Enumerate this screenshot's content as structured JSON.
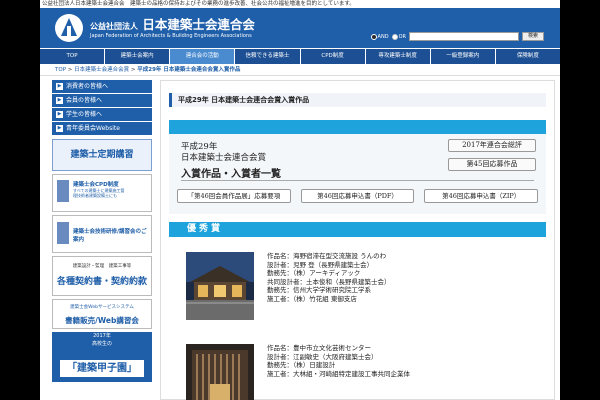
{
  "topline": "公益社団法人日本建築士会連合会　建築士の品格の保持およびその業務の進歩改善、社会公共の福祉増進を目的としています。",
  "header": {
    "org_prefix": "公益社団法人",
    "org_name": "日本建築士会連合会",
    "org_en": "Japan Federation of Architects & Building Engineers Associations",
    "radio_and": "AND",
    "radio_or": "OR",
    "search_placeholder": "",
    "search_button": "検索"
  },
  "nav": [
    {
      "label": "TOP",
      "active": false
    },
    {
      "label": "建築士会案内",
      "active": false
    },
    {
      "label": "連合会の活動",
      "active": true
    },
    {
      "label": "信頼できる建築士",
      "active": false
    },
    {
      "label": "CPD制度",
      "active": false
    },
    {
      "label": "専攻建築士制度",
      "active": false
    },
    {
      "label": "一級登録案内",
      "active": false
    },
    {
      "label": "保険制度",
      "active": false
    }
  ],
  "breadcrumb": {
    "top": "TOP",
    "sep": ">",
    "level1": "日本建築士会連合会賞",
    "current": "平成29年 日本建築士会連合会賞入賞作品"
  },
  "sidebar": {
    "links": [
      "消費者の皆様へ",
      "会員の皆様へ",
      "学生の皆様へ",
      "青年委員会Website"
    ],
    "kouza": "建築士定期講習",
    "cpd_title": "建築士会CPD制度",
    "cpd_sub": "すべての建築士に建築施工管理技術者建築設備士にも",
    "gijutsu_title": "建築士会技術研修/講習会のご案内",
    "keiyaku_top": "建築設計・監理　建築工事等",
    "keiyaku_main": "各種契約書・契約約款",
    "shoseki_top": "建築士会Webサービスシステム",
    "shoseki_main": "書籍販売/Web講習会",
    "koshien_year": "2017年",
    "koshien_label": "高校生の",
    "koshien_main": "「建築甲子園」"
  },
  "content": {
    "heading": "平成29年 日本建築士会連合会賞入賞作品",
    "award_line1": "平成29年",
    "award_line2": "日本建築士会連合会賞",
    "award_line3": "入賞作品・入賞者一覧",
    "btn_soshi": "2017年連合会総評",
    "btn_sakuhin": "第45回応募作品",
    "dl_buttons": [
      "「第46回会員作品展」応募要項",
      "第46回応募申込書（PDF）",
      "第46回応募申込書（ZIP）"
    ],
    "yushu": "優秀賞",
    "entries": [
      {
        "work": "作品名：海野宿滞在型交流施設 うんのわ",
        "designer": "設計者：児野 登（長野県建築士会）",
        "office": "勤務先：（株）アーキディアック",
        "co_designer": "共同設計者：土本俊和（長野県建築士会）",
        "co_office": "勤務先：信州大学学術研究院工学系",
        "builder": "施工者：（株）竹花組 東御支店"
      },
      {
        "work": "作品名：豊中市立文化芸術センター",
        "designer": "設計者：江副敏史（大阪府建築士会）",
        "office": "勤務先：（株）日建設計",
        "co_designer": "",
        "co_office": "",
        "builder": "施工者：大林組・河崎組特定建設工事共同企業体"
      }
    ]
  },
  "colors": {
    "brand_blue": "#1f5ea8",
    "nav_active": "#4a8bd0",
    "section_cyan": "#1fa3dc"
  }
}
